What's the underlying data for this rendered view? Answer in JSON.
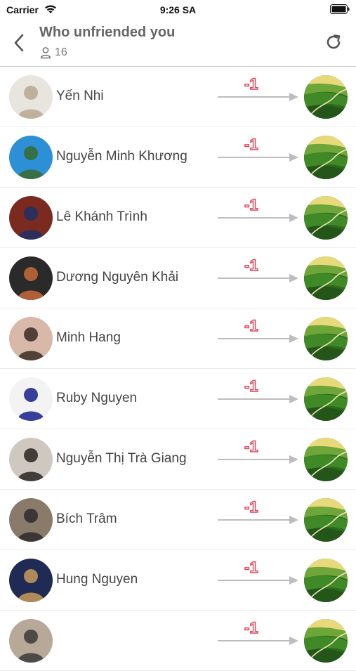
{
  "status_bar": {
    "carrier": "Carrier",
    "time": "9:26 SA"
  },
  "header": {
    "title": "Who unfriended you",
    "count": "16",
    "back_icon": "chevron-left-icon",
    "refresh_icon": "refresh-icon",
    "user_icon": "person-icon"
  },
  "rows": [
    {
      "name": "Yến Nhi",
      "delta": "-1",
      "avatar_bg": "#e8e4de",
      "avatar_fg": "#b9a890"
    },
    {
      "name": "Nguyễn Minh Khương",
      "delta": "-1",
      "avatar_bg": "#2d8fd6",
      "avatar_fg": "#3a6b2a"
    },
    {
      "name": "Lê Khánh Trình",
      "delta": "-1",
      "avatar_bg": "#7a2a1f",
      "avatar_fg": "#1f2f66"
    },
    {
      "name": "Dương Nguyên Khải",
      "delta": "-1",
      "avatar_bg": "#2a2a2a",
      "avatar_fg": "#c86a3a"
    },
    {
      "name": "Minh Hang",
      "delta": "-1",
      "avatar_bg": "#d8b8a8",
      "avatar_fg": "#3a2a22"
    },
    {
      "name": "Ruby Nguyen",
      "delta": "-1",
      "avatar_bg": "#f3f3f3",
      "avatar_fg": "#14208a"
    },
    {
      "name": "Nguyễn Thị Trà Giang",
      "delta": "-1",
      "avatar_bg": "#cfc8c0",
      "avatar_fg": "#2a2422"
    },
    {
      "name": "Bích Trâm",
      "delta": "-1",
      "avatar_bg": "#8a7a6a",
      "avatar_fg": "#2a2a2a"
    },
    {
      "name": "Hung Nguyen",
      "delta": "-1",
      "avatar_bg": "#1f2a55",
      "avatar_fg": "#c89a5a"
    },
    {
      "name": "",
      "delta": "-1",
      "avatar_bg": "#b8a898",
      "avatar_fg": "#3a3a3a"
    }
  ],
  "colors": {
    "delta": "#e0455a",
    "arrow": "#bdbdbd",
    "divider": "#ececec"
  }
}
